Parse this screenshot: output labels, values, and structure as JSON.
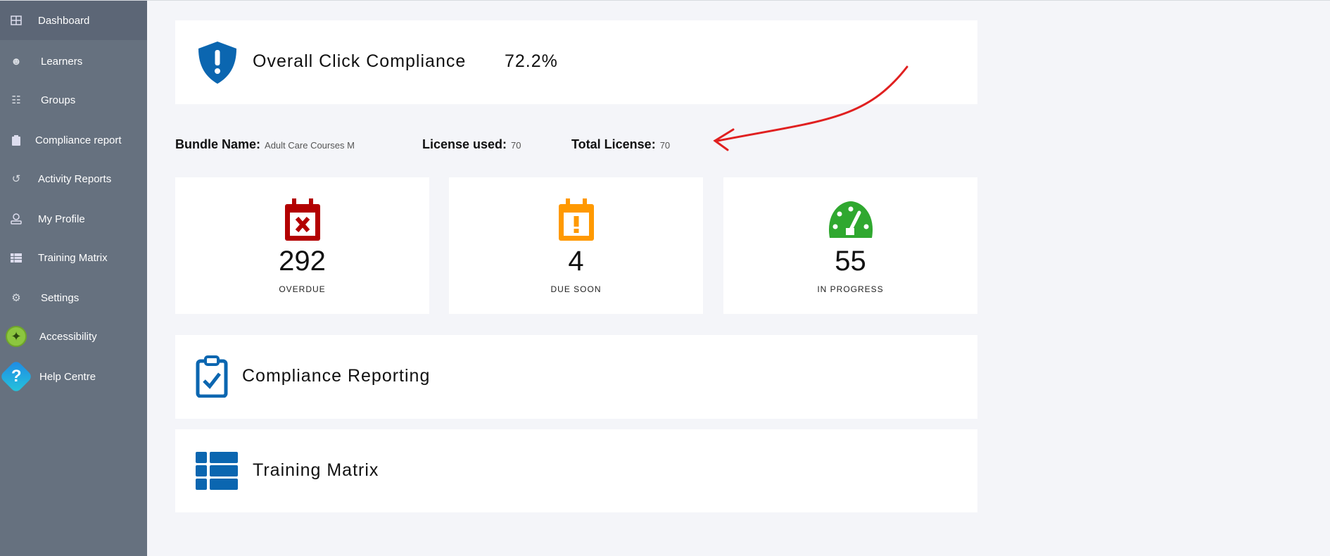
{
  "sidebar": {
    "items": [
      {
        "label": "Dashboard",
        "icon": "grid-icon"
      },
      {
        "label": "Learners",
        "icon": "users-icon"
      },
      {
        "label": "Groups",
        "icon": "groups-icon"
      },
      {
        "label": "Compliance report",
        "icon": "clipboard-icon"
      },
      {
        "label": "Activity Reports",
        "icon": "history-icon"
      },
      {
        "label": "My Profile",
        "icon": "user-icon"
      },
      {
        "label": "Training Matrix",
        "icon": "table-icon"
      },
      {
        "label": "Settings",
        "icon": "gears-icon"
      },
      {
        "label": "Accessibility",
        "icon": "accessibility-icon"
      },
      {
        "label": "Help Centre",
        "icon": "help-icon"
      }
    ]
  },
  "compliance": {
    "title": "Overall Click Compliance",
    "value": "72.2%",
    "color": "#0b66b0"
  },
  "bundle": {
    "name_label": "Bundle Name:",
    "name": "Adult Care Courses M",
    "used_label": "License used:",
    "used": "70",
    "total_label": "Total License:",
    "total": "70"
  },
  "stats": [
    {
      "value": "292",
      "label": "OVERDUE",
      "color": "#b30000"
    },
    {
      "value": "4",
      "label": "DUE SOON",
      "color": "#ff9900"
    },
    {
      "value": "55",
      "label": "IN PROGRESS",
      "color": "#2fa82f"
    }
  ],
  "reporting": {
    "title": "Compliance Reporting"
  },
  "matrix": {
    "title": "Training Matrix"
  },
  "annotation_color": "#e02020"
}
